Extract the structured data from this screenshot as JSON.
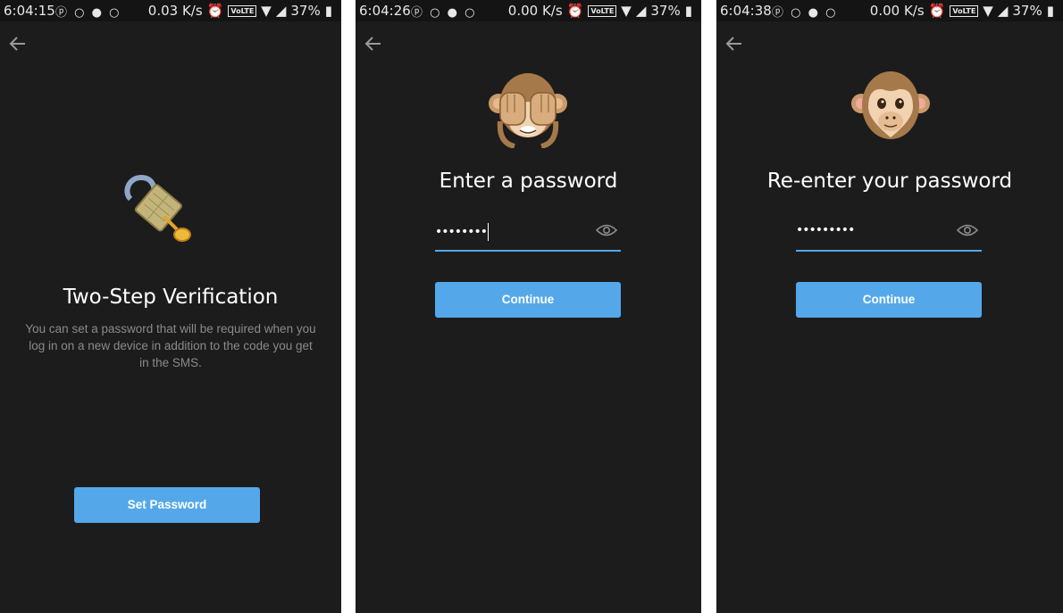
{
  "screens": [
    {
      "status": {
        "time": "6:04:15",
        "speed": "0.03 K/s",
        "volte": "VoLTE",
        "battery": "37%"
      },
      "title": "Two-Step Verification",
      "description": "You can set a password that will be required when you log in on a new device in addition to the code you get in the SMS.",
      "button": "Set Password",
      "emoji": "lock-with-key-icon"
    },
    {
      "status": {
        "time": "6:04:26",
        "speed": "0.00 K/s",
        "volte": "VoLTE",
        "battery": "37%"
      },
      "title": "Enter a password",
      "password_value": "••••••••",
      "button": "Continue",
      "emoji": "see-no-evil-monkey-icon"
    },
    {
      "status": {
        "time": "6:04:38",
        "speed": "0.00 K/s",
        "volte": "VoLTE",
        "battery": "37%"
      },
      "title": "Re-enter your password",
      "password_value": "•••••••••",
      "button": "Continue",
      "emoji": "monkey-face-icon"
    }
  ],
  "colors": {
    "background": "#1c1c1d",
    "accent": "#54a8ea",
    "text": "#ffffff",
    "muted": "#8a8a8a"
  }
}
